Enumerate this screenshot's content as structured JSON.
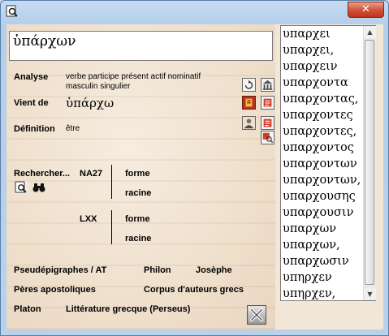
{
  "window": {
    "close_glyph": "✕"
  },
  "input": {
    "value": "ὑπάρχων"
  },
  "analyse": {
    "label": "Analyse",
    "line1": "verbe participe présent actif nominatif",
    "line2": "masculin singulier"
  },
  "vient_de": {
    "label": "Vient de",
    "value": "ὑπάρχω"
  },
  "definition": {
    "label": "Définition",
    "value": "être"
  },
  "search": {
    "label": "Rechercher...",
    "na27": "NA27",
    "lxx": "LXX",
    "forme": "forme",
    "racine": "racine"
  },
  "links": {
    "pseudepigraphes": "Pseudépigraphes / AT",
    "philon": "Philon",
    "josephe": "Josèphe",
    "peres": "Pères apostoliques",
    "corpus": "Corpus d'auteurs grecs",
    "platon": "Platon",
    "litterature": "Littérature grecque (Perseus)"
  },
  "word_list": [
    "υπαρχει",
    "υπαρχει,",
    "υπαρχειν",
    "υπαρχοντα",
    "υπαρχοντας,",
    "υπαρχοντες",
    "υπαρχοντες,",
    "υπαρχοντος",
    "υπαρχοντων",
    "υπαρχοντων,",
    "υπαρχουσης",
    "υπαρχουσιν",
    "υπαρχων",
    "υπαρχων,",
    "υπαρχωσιν",
    "υπηρχεν",
    "υπηρχεν,"
  ],
  "colors": {
    "titlebar": "#b9d2ec",
    "close": "#c0321c",
    "background": "#f2e6d6"
  }
}
